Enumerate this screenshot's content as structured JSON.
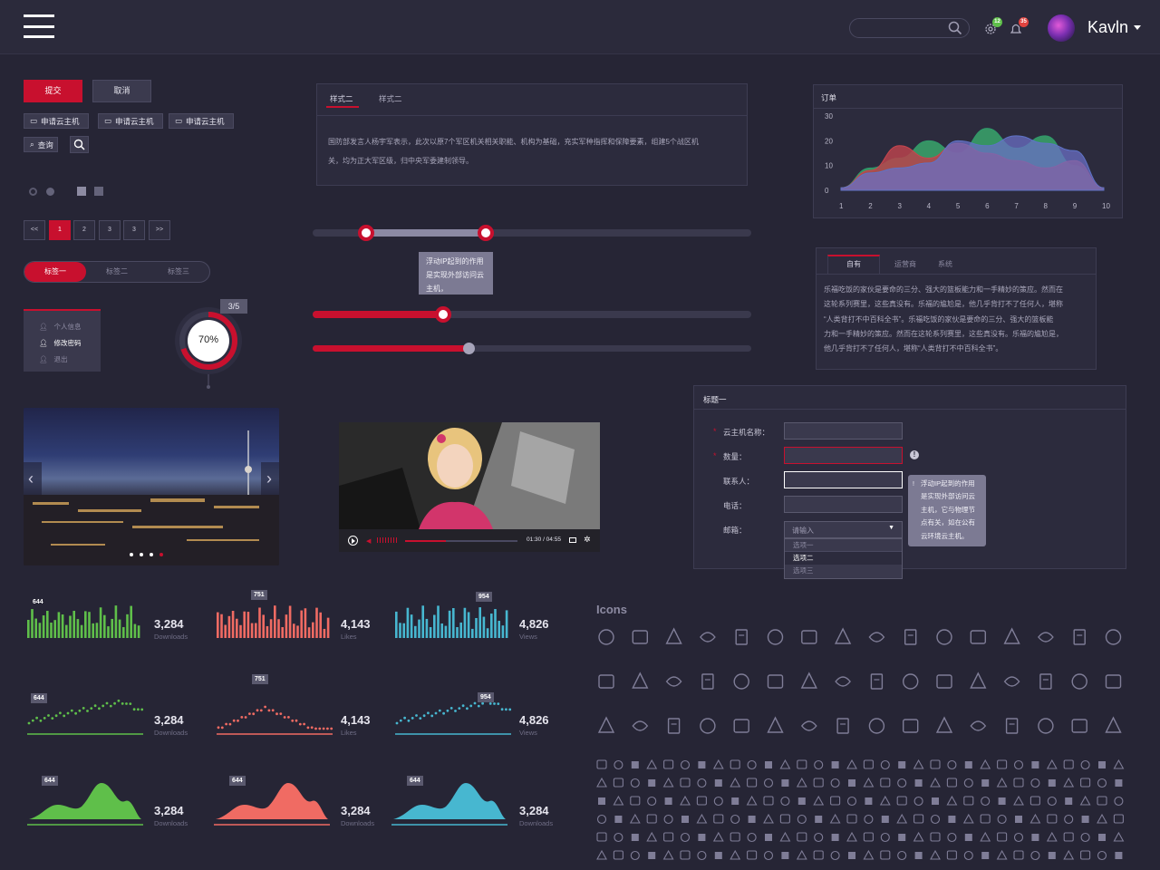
{
  "header": {
    "username": "Kavln",
    "settings_badge": "12",
    "notify_badge": "35",
    "accent_green": "#5fbf4a",
    "accent_red": "#e0433f"
  },
  "buttons": {
    "submit": "提交",
    "cancel": "取消",
    "apply_host": [
      "申请云主机",
      "申请云主机",
      "申请云主机"
    ],
    "query": "查询"
  },
  "pagination": {
    "items": [
      "<<",
      "1",
      "2",
      "3",
      "3",
      ">>"
    ],
    "active": "1"
  },
  "segmented": {
    "items": [
      "标签一",
      "标签二",
      "标签三"
    ],
    "active": "标签一"
  },
  "user_menu": {
    "items": [
      "个人信息",
      "修改密码",
      "退出"
    ],
    "active": "修改密码"
  },
  "gauge": {
    "percent": "70%",
    "step": "3/5"
  },
  "tabs_card": {
    "tabs": [
      "样式二",
      "样式二"
    ],
    "text_line1": "国防部发言人杨宇军表示，此次以原7个军区机关相关职能、机构为基础，充实军种指挥和保障要素，组建5个战区机",
    "text_line2": "关，均为正大军区级，归中央军委建制领导。"
  },
  "sliders": {
    "tooltip_line1": "浮动IP起到的作用",
    "tooltip_line2": "是实现外部访问云",
    "tooltip_line3": "主机，"
  },
  "area_chart": {
    "title": "订单",
    "y_ticks": [
      "30",
      "20",
      "10",
      "0"
    ],
    "x_ticks": [
      "1",
      "2",
      "3",
      "4",
      "5",
      "6",
      "7",
      "8",
      "9",
      "10"
    ]
  },
  "chart_data": {
    "type": "area",
    "title": "订单",
    "x": [
      1,
      2,
      3,
      4,
      5,
      6,
      7,
      8,
      9,
      10
    ],
    "ylim": [
      0,
      30
    ],
    "series": [
      {
        "values": [
          1,
          9,
          13,
          20,
          15,
          25,
          17,
          22,
          10,
          1
        ]
      },
      {
        "values": [
          1,
          8,
          18,
          13,
          19,
          15,
          12,
          9,
          12,
          1
        ]
      },
      {
        "values": [
          1,
          7,
          9,
          11,
          20,
          18,
          22,
          19,
          16,
          1
        ]
      }
    ]
  },
  "info_card": {
    "tabs": [
      "自有",
      "运营商",
      "系统"
    ],
    "lines": [
      "乐福吃饭的家伙是要命的三分、强大的篮板能力和一手精妙的策应。然而在",
      "这轮系列赛里，这些真没有。乐福的尴尬是，他几乎背打不了任何人，堪称",
      "“人类背打不中百科全书”。乐福吃饭的家伙是要命的三分、强大的篮板能",
      "力和一手精妙的策应。然而在这轮系列赛里，这些真没有。乐福的尴尬是，",
      "他几乎背打不了任何人，堪称“人类背打不中百科全书”。"
    ]
  },
  "form": {
    "title": "标题一",
    "labels": [
      "云主机名称：",
      "数量：",
      "联系人：",
      "电话：",
      "邮箱："
    ],
    "select_placeholder": "请输入",
    "options": [
      "选项一",
      "选项二",
      "选项三"
    ],
    "tooltip_lines": [
      "浮动IP起到的作用",
      "是实现外部访问云",
      "主机，它与物理节",
      "点有关，如在公有",
      "云环境云主机。"
    ]
  },
  "video": {
    "time": "01:30 / 04:55"
  },
  "stats": [
    {
      "num": "3,284",
      "sub": "Downloads",
      "flag": "644",
      "color": "#5fbf4a"
    },
    {
      "num": "4,143",
      "sub": "Likes",
      "flag": "751",
      "color": "#f06b63"
    },
    {
      "num": "4,826",
      "sub": "Views",
      "flag": "954",
      "color": "#47b7d0"
    }
  ],
  "stats_row3": [
    {
      "num": "3,284",
      "sub": "Downloads",
      "flag": "644"
    },
    {
      "num": "3,284",
      "sub": "Downloads",
      "flag": "644"
    },
    {
      "num": "3,284",
      "sub": "Downloads",
      "flag": "644"
    }
  ],
  "icons_title": "Icons"
}
